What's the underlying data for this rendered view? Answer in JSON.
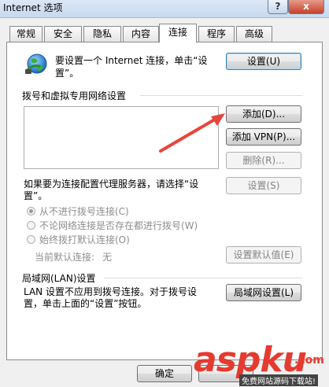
{
  "window": {
    "title": "Internet 选项",
    "help_label": "?",
    "close_label": "x"
  },
  "tabs": [
    {
      "label": "常规"
    },
    {
      "label": "安全"
    },
    {
      "label": "隐私"
    },
    {
      "label": "内容"
    },
    {
      "label": "连接",
      "active": true
    },
    {
      "label": "程序"
    },
    {
      "label": "高级"
    }
  ],
  "connect": {
    "setup_text_line1": "要设置一个 Internet 连接，单击“设",
    "setup_text_line2": "置”。",
    "setup_button": "设置(U)"
  },
  "dialup": {
    "section_title": "拨号和虚拟专用网络设置",
    "add_button": "添加(D)...",
    "add_vpn_button": "添加 VPN(P)...",
    "remove_button": "删除(R)...",
    "proxy_text_line1": "如果要为连接配置代理服务器，请选择“设",
    "proxy_text_line2": "置”。",
    "settings_button": "设置(S)",
    "radio_never": "从不进行拨号连接(C)",
    "radio_no_network": "不论网络连接是否存在都进行拨号(W)",
    "radio_always": "始终拨打默认连接(O)",
    "current_default_label": "当前默认连接:",
    "current_default_value": "无",
    "set_default_button": "设置默认值(E)"
  },
  "lan": {
    "section_title": "局域网(LAN)设置",
    "text_line1": "LAN 设置不应用到拨号连接。对于拨号设",
    "text_line2": "置，单击上面的“设置”按钮。",
    "lan_button": "局域网设置(L)"
  },
  "footer": {
    "ok_button": "确定"
  },
  "watermark": {
    "text": "aspku",
    "sub": ".com",
    "tagline": "免费网站源码下载站!"
  },
  "colors": {
    "arrow": "#e8453c",
    "watermark_red": "#e53a2f"
  }
}
